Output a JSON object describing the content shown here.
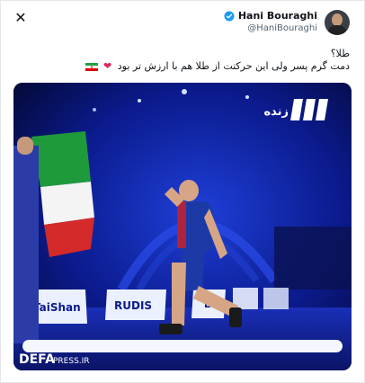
{
  "tweet": {
    "author_name": "Hani Bouraghi",
    "author_handle": "@HaniBouraghi",
    "text_line1": "طلا؟",
    "text_line2": "دمت گرم پسر ولی این حرکتت از طلا هم با ارزش تر بود"
  },
  "media": {
    "channel_logo": "زنده",
    "board_left": "TaiShan",
    "board_center": "RUDIS",
    "board_right": "EP",
    "watermark_brand": "DEFA",
    "watermark_domain": "PRESS.IR"
  },
  "icons": {
    "close": "close-icon",
    "verified": "verified-badge-icon",
    "flag": "iran-flag-emoji",
    "heart": "red-heart-emoji"
  },
  "colors": {
    "verified": "#1d9bf0",
    "heart": "#e0245e",
    "arena_blue": "#0b1a8c"
  }
}
